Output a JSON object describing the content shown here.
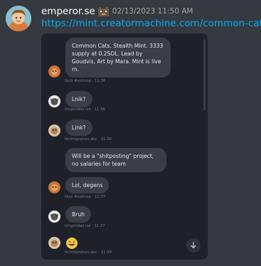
{
  "message": {
    "username": "emperor.se",
    "timestamp": "02/13/2023 11:50 AM",
    "link": "https://mint.creatormachine.com/common-cats"
  },
  "embed_chat": {
    "messages": [
      {
        "text": "Common Cats. Stealth Mint. 3333 supply at 0.2SOL. Lead by Goudvis, Art by Mara. Mint is live rn.",
        "sender": "Nulz #solmop · 11:36"
      },
      {
        "text": "Lnik?",
        "sender": "kingmidas.sol · 11:36"
      },
      {
        "text": "Link?",
        "sender": "ferimigration.abc · 11:36"
      },
      {
        "text": "Will be a \"shitposting\" project, no salaries for team",
        "sender": ""
      },
      {
        "text": "Lol, degens",
        "sender": "Nulz #solmop · 11:37"
      },
      {
        "text": "Bruh",
        "sender": "kingmidas.sol · 11:37"
      },
      {
        "text": "",
        "sender": "ferimigration.abc · 11:38"
      }
    ]
  },
  "icons": {
    "badge": "pixel-cat-badge-icon",
    "scroll_down": "arrow-down-icon",
    "reaction": "rofl-emoji-icon"
  },
  "colors": {
    "background": "#36393f",
    "link": "#00aff4",
    "embed_bg": "#1e2128",
    "bubble": "#3b3e46"
  }
}
